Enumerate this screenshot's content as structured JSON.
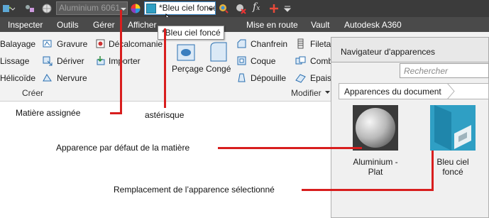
{
  "toolbar": {
    "material_value": "Aluminium 6061",
    "appearance_value": "*Bleu ciel foncé",
    "tooltip": "*Bleu ciel foncé"
  },
  "menu": [
    "Inspecter",
    "Outils",
    "Gérer",
    "Afficher",
    "Mise en route",
    "Vault",
    "Autodesk A360"
  ],
  "ribbon": {
    "col1": [
      "Balayage",
      "Lissage",
      "Hélicoïde"
    ],
    "col2": [
      "Gravure",
      "Dériver",
      "Nervure"
    ],
    "col3": [
      "Décalcomanie",
      "Importer"
    ],
    "group_create": "Créer",
    "percage": "Perçage",
    "conge": "Congé",
    "col4": [
      "Chanfrein",
      "Coque",
      "Dépouille"
    ],
    "col5": [
      "Filetage",
      "Combiner",
      "Epaissir"
    ],
    "group_modify": "Modifier"
  },
  "navigator": {
    "title": "Navigateur d'apparences",
    "search_placeholder": "Rechercher",
    "breadcrumb": "Apparences du document",
    "items": [
      {
        "label": "Aluminium - Plat"
      },
      {
        "label": "Bleu ciel foncé"
      }
    ]
  },
  "annotations": {
    "assigned": "Matière assignée",
    "asterisk": "astérisque",
    "default": "Apparence par défaut de la matière",
    "override": "Remplacement de l’apparence sélectionné"
  },
  "colors": {
    "accent_red": "#d81e1e",
    "appearance_blue": "#2f9fc4",
    "toolbar_dark": "#3b3b3b",
    "menubar": "#4a4a4a"
  }
}
